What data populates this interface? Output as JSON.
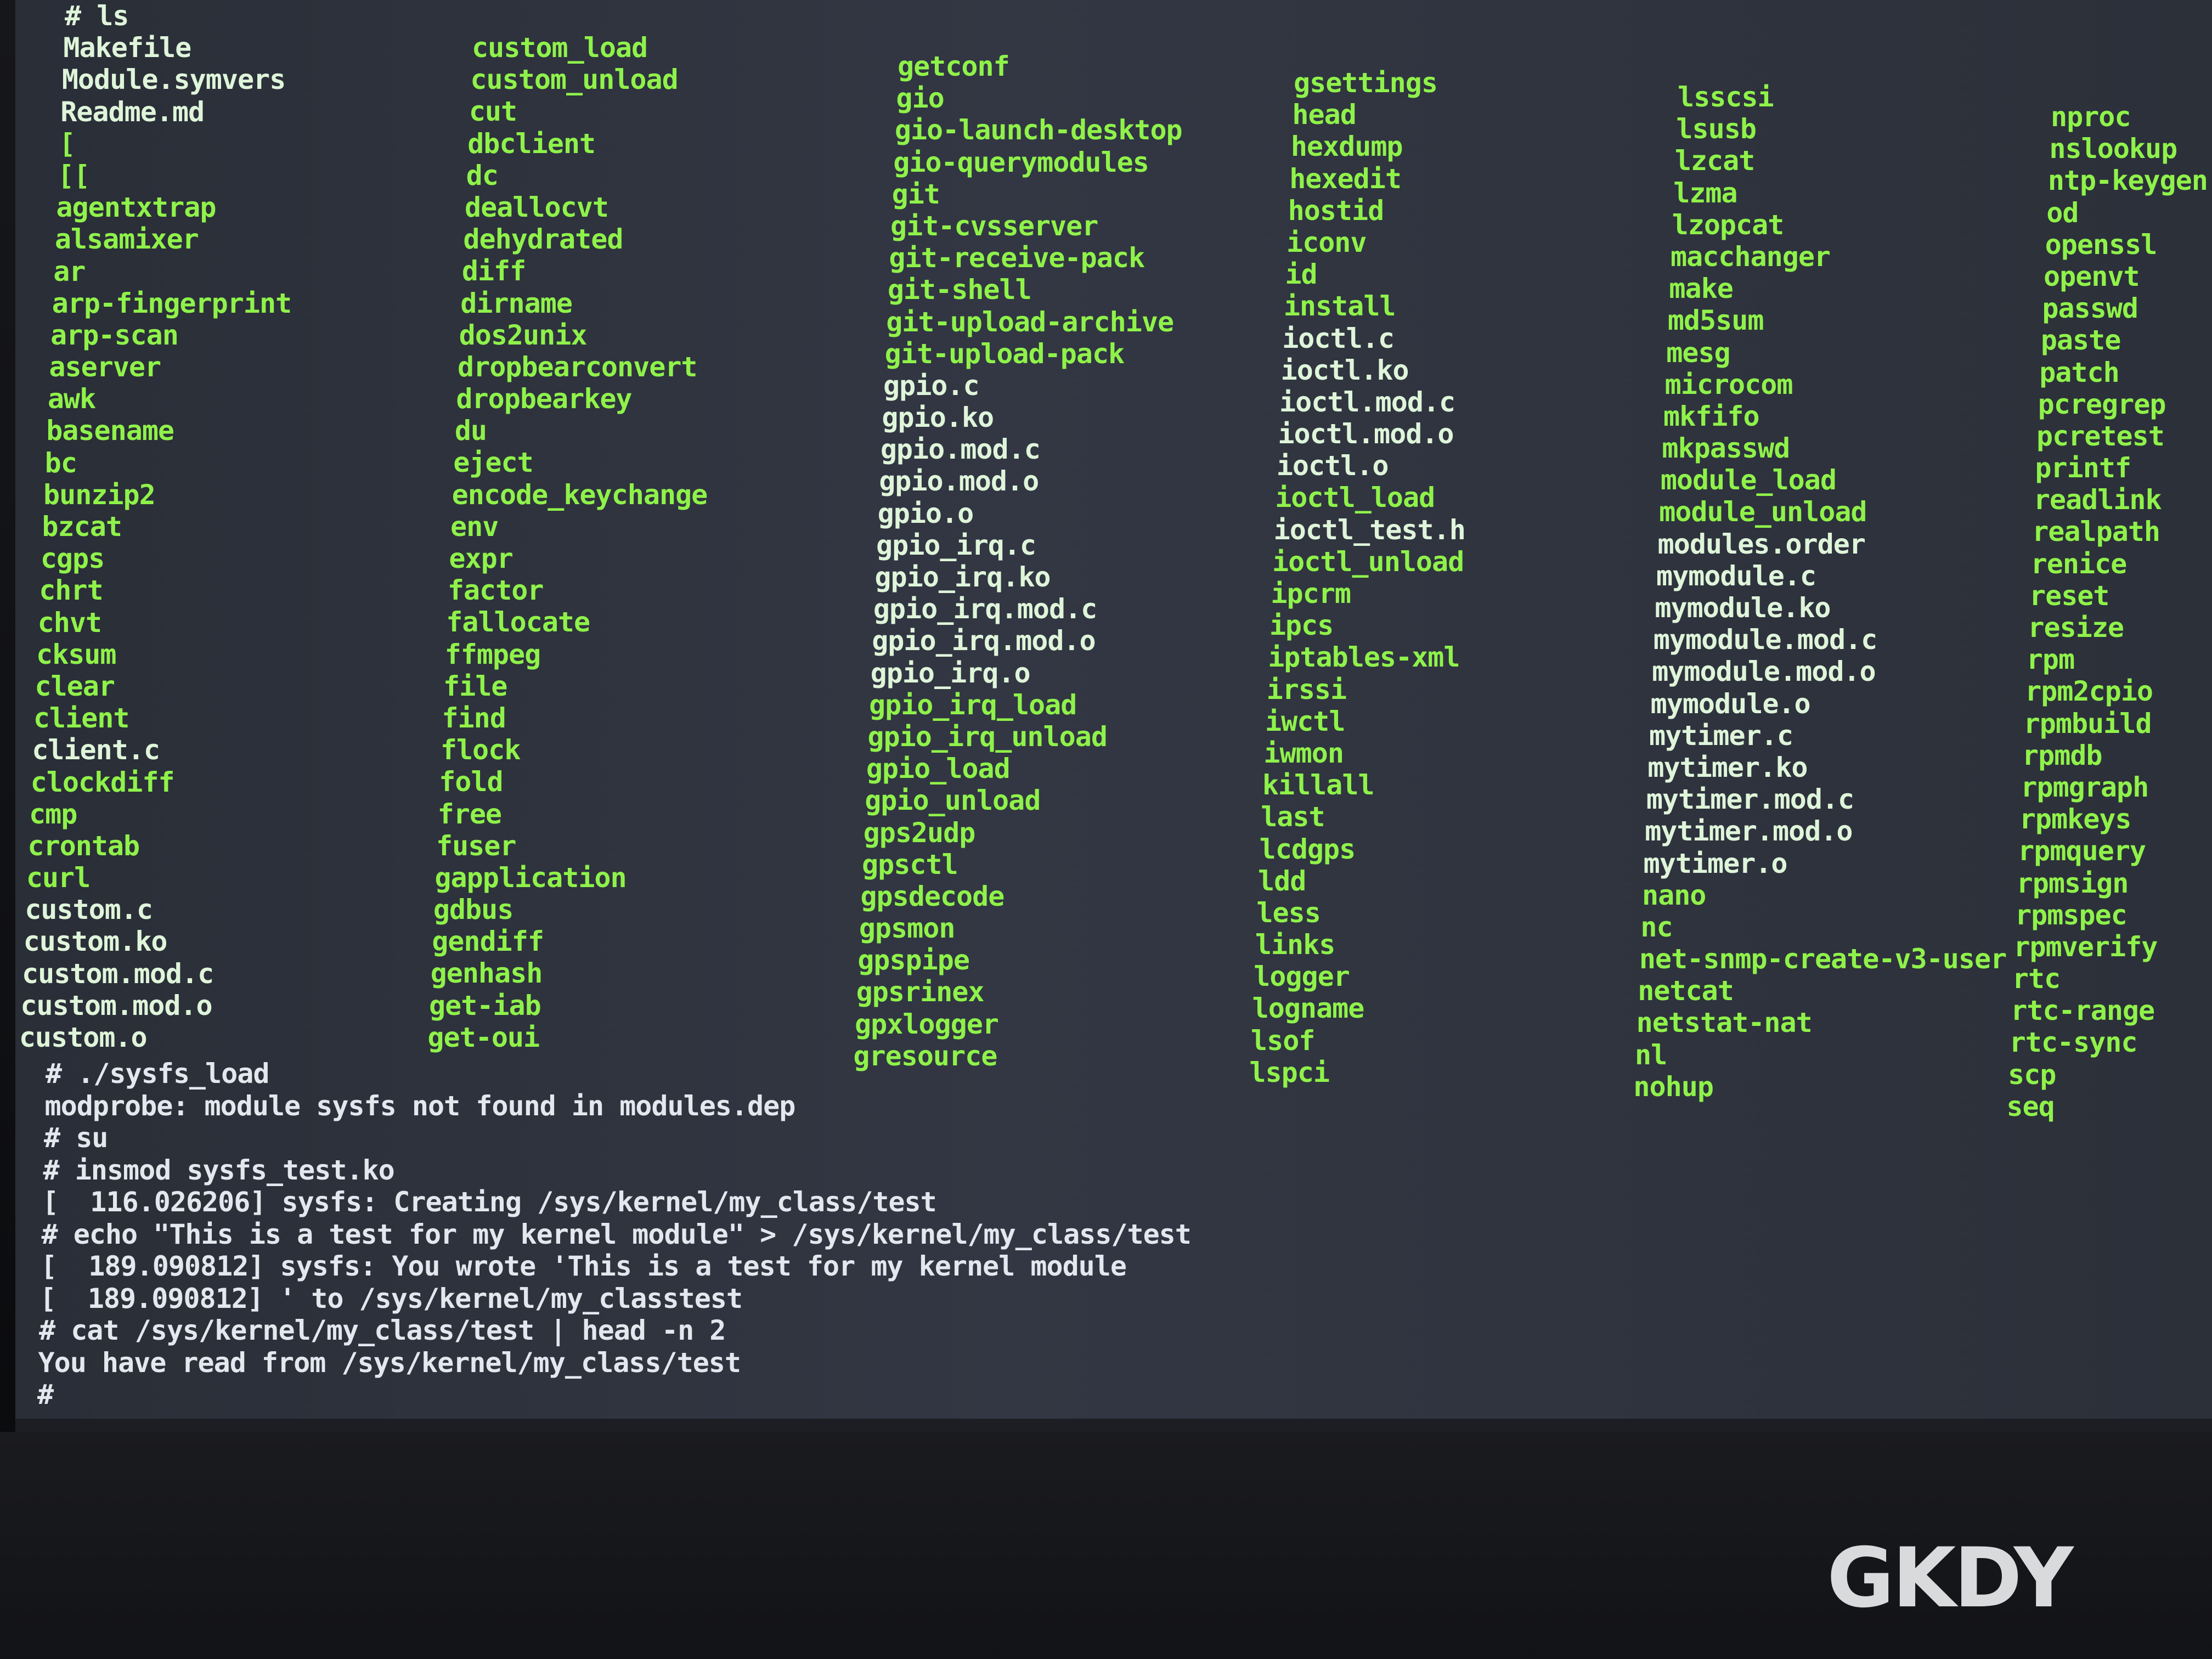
{
  "colors": {
    "exec": "#8ff24a",
    "file": "#dff5da",
    "console_text": "#e4e7ee",
    "logo": "#d9dadc"
  },
  "terminal": {
    "columns": [
      [
        "# ls",
        "Makefile",
        "Module.symvers",
        "Readme.md",
        "[",
        "[[",
        "agentxtrap",
        "alsamixer",
        "ar",
        "arp-fingerprint",
        "arp-scan",
        "aserver",
        "awk",
        "basename",
        "bc",
        "bunzip2",
        "bzcat",
        "cgps",
        "chrt",
        "chvt",
        "cksum",
        "clear",
        "client",
        "client.c",
        "clockdiff",
        "cmp",
        "crontab",
        "curl",
        "custom.c",
        "custom.ko",
        "custom.mod.c",
        "custom.mod.o",
        "custom.o"
      ],
      [
        "custom_load",
        "custom_unload",
        "cut",
        "dbclient",
        "dc",
        "deallocvt",
        "dehydrated",
        "diff",
        "dirname",
        "dos2unix",
        "dropbearconvert",
        "dropbearkey",
        "du",
        "eject",
        "encode_keychange",
        "env",
        "expr",
        "factor",
        "fallocate",
        "ffmpeg",
        "file",
        "find",
        "flock",
        "fold",
        "free",
        "fuser",
        "gapplication",
        "gdbus",
        "gendiff",
        "genhash",
        "get-iab",
        "get-oui"
      ],
      [
        "getconf",
        "gio",
        "gio-launch-desktop",
        "gio-querymodules",
        "git",
        "git-cvsserver",
        "git-receive-pack",
        "git-shell",
        "git-upload-archive",
        "git-upload-pack",
        "gpio.c",
        "gpio.ko",
        "gpio.mod.c",
        "gpio.mod.o",
        "gpio.o",
        "gpio_irq.c",
        "gpio_irq.ko",
        "gpio_irq.mod.c",
        "gpio_irq.mod.o",
        "gpio_irq.o",
        "gpio_irq_load",
        "gpio_irq_unload",
        "gpio_load",
        "gpio_unload",
        "gps2udp",
        "gpsctl",
        "gpsdecode",
        "gpsmon",
        "gpspipe",
        "gpsrinex",
        "gpxlogger",
        "gresource"
      ],
      [
        "gsettings",
        "head",
        "hexdump",
        "hexedit",
        "hostid",
        "iconv",
        "id",
        "install",
        "ioctl.c",
        "ioctl.ko",
        "ioctl.mod.c",
        "ioctl.mod.o",
        "ioctl.o",
        "ioctl_load",
        "ioctl_test.h",
        "ioctl_unload",
        "ipcrm",
        "ipcs",
        "iptables-xml",
        "irssi",
        "iwctl",
        "iwmon",
        "killall",
        "last",
        "lcdgps",
        "ldd",
        "less",
        "links",
        "logger",
        "logname",
        "lsof",
        "lspci"
      ],
      [
        "lsscsi",
        "lsusb",
        "lzcat",
        "lzma",
        "lzopcat",
        "macchanger",
        "make",
        "md5sum",
        "mesg",
        "microcom",
        "mkfifo",
        "mkpasswd",
        "module_load",
        "module_unload",
        "modules.order",
        "mymodule.c",
        "mymodule.ko",
        "mymodule.mod.c",
        "mymodule.mod.o",
        "mymodule.o",
        "mytimer.c",
        "mytimer.ko",
        "mytimer.mod.c",
        "mytimer.mod.o",
        "mytimer.o",
        "nano",
        "nc",
        "net-snmp-create-v3-user",
        "netcat",
        "netstat-nat",
        "nl",
        "nohup"
      ],
      [
        "nproc",
        "nslookup",
        "ntp-keygen",
        "od",
        "openssl",
        "openvt",
        "passwd",
        "paste",
        "patch",
        "pcregrep",
        "pcretest",
        "printf",
        "readlink",
        "realpath",
        "renice",
        "reset",
        "resize",
        "rpm",
        "rpm2cpio",
        "rpmbuild",
        "rpmdb",
        "rpmgraph",
        "rpmkeys",
        "rpmquery",
        "rpmsign",
        "rpmspec",
        "rpmverify",
        "rtc",
        "rtc-range",
        "rtc-sync",
        "scp",
        "seq"
      ]
    ],
    "file_entries": [
      "Makefile",
      "Module.symvers",
      "Readme.md",
      "client.c",
      "custom.c",
      "custom.ko",
      "custom.mod.c",
      "custom.mod.o",
      "custom.o",
      "gpio.c",
      "gpio.ko",
      "gpio.mod.c",
      "gpio.mod.o",
      "gpio.o",
      "gpio_irq.c",
      "gpio_irq.ko",
      "gpio_irq.mod.c",
      "gpio_irq.mod.o",
      "gpio_irq.o",
      "ioctl.c",
      "ioctl.ko",
      "ioctl.mod.c",
      "ioctl.mod.o",
      "ioctl.o",
      "ioctl_test.h",
      "modules.order",
      "mymodule.c",
      "mymodule.ko",
      "mymodule.mod.c",
      "mymodule.mod.o",
      "mymodule.o",
      "mytimer.c",
      "mytimer.ko",
      "mytimer.mod.c",
      "mytimer.mod.o",
      "mytimer.o",
      "# ls"
    ],
    "console_lines": [
      "# ./sysfs_load",
      "modprobe: module sysfs not found in modules.dep",
      "# su",
      "# insmod sysfs_test.ko",
      "[  116.026206] sysfs: Creating /sys/kernel/my_class/test",
      "# echo \"This is a test for my kernel module\" > /sys/kernel/my_class/test",
      "[  189.090812] sysfs: You wrote 'This is a test for my kernel module",
      "[  189.090812] ' to /sys/kernel/my_classtest",
      "# cat /sys/kernel/my_class/test | head -n 2",
      "You have read from /sys/kernel/my_class/test",
      "#"
    ]
  },
  "monitor": {
    "brand": "GKDY"
  }
}
